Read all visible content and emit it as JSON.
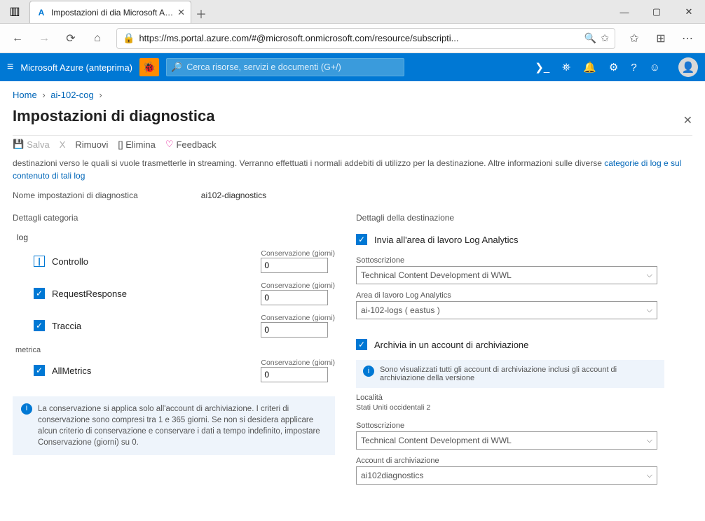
{
  "browser": {
    "tab_title": "Impostazioni di dia Microsoft A…",
    "url": "https://ms.portal.azure.com/#@microsoft.onmicrosoft.com/resource/subscripti..."
  },
  "header": {
    "brand": "Microsoft Azure (anteprima)",
    "search_placeholder": "Cerca risorse, servizi e documenti (G+/)"
  },
  "breadcrumb": {
    "home": "Home",
    "resource": "ai-102-cog"
  },
  "page_title": "Impostazioni di diagnostica",
  "toolbar": {
    "save": "Salva",
    "discard": "X",
    "remove": "Rimuovi",
    "delete": "[] Elimina",
    "feedback": "Feedback"
  },
  "description_part": "destinazioni verso le quali si vuole trasmetterle in streaming. Verranno effettuati i normali addebiti di utilizzo per la destinazione. Altre informazioni sulle diverse",
  "description_link": "categorie di log e sul contenuto di tali log",
  "setting_name_label": "Nome impostazioni di diagnostica",
  "setting_name_value": "ai102-diagnostics",
  "details_cat": "Dettagli categoria",
  "details_dest": "Dettagli della destinazione",
  "log_label": "log",
  "metric_label": "metrica",
  "categories": [
    {
      "label": "Controllo",
      "checked": "dash",
      "retention": "0"
    },
    {
      "label": "RequestResponse",
      "checked": "checked",
      "retention": "0"
    },
    {
      "label": "Traccia",
      "checked": "checked",
      "retention": "0"
    }
  ],
  "metrics": [
    {
      "label": "AllMetrics",
      "checked": "checked",
      "retention": "0"
    }
  ],
  "retention_label": "Conservazione (giorni)",
  "retention_info": "La conservazione si applica solo all'account di archiviazione. I criteri di conservazione sono compresi tra 1 e 365 giorni. Se non si desidera applicare alcun criterio di conservazione e conservare i dati a tempo indefinito, impostare Conservazione (giorni) su 0.",
  "dest": {
    "log_analytics": "Invia all'area di lavoro Log Analytics",
    "sub_label": "Sottoscrizione",
    "sub_value": "Technical Content Development di WWL",
    "workspace_label": "Area di lavoro Log Analytics",
    "workspace_value": "ai-102-logs ( eastus )",
    "archive": "Archivia in un account di archiviazione",
    "archive_info": "Sono visualizzati tutti gli account di archiviazione inclusi gli account di archiviazione della versione",
    "location_label": "Località",
    "location_value": "Stati Uniti occidentali 2",
    "storage_sub_label": "Sottoscrizione",
    "storage_sub_value": "Technical Content Development di WWL",
    "storage_acc_label": "Account di archiviazione",
    "storage_acc_value": "ai102diagnostics"
  }
}
